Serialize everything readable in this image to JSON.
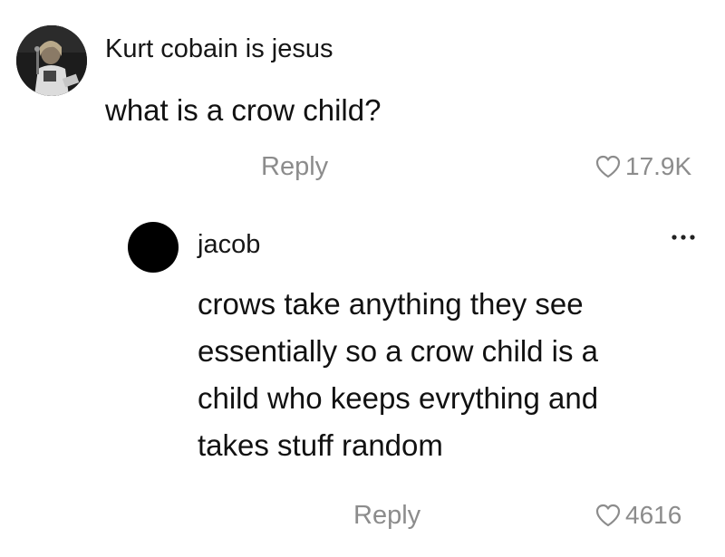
{
  "comments": [
    {
      "username": "Kurt cobain is jesus",
      "text": "what is a crow child?",
      "reply_label": "Reply",
      "likes": "17.9K",
      "avatar_icon": "user-photo-avatar"
    },
    {
      "username": "jacob",
      "text_lines": [
        "crows take anything they see",
        "essentially so a crow child is a",
        "child who keeps evrything and",
        "takes stuff random"
      ],
      "reply_label": "Reply",
      "likes": "4616",
      "avatar_icon": "black-circle-avatar",
      "more_icon": "more-options-icon"
    }
  ],
  "colors": {
    "text": "#111111",
    "muted": "#8c8c8c",
    "background": "#ffffff"
  }
}
